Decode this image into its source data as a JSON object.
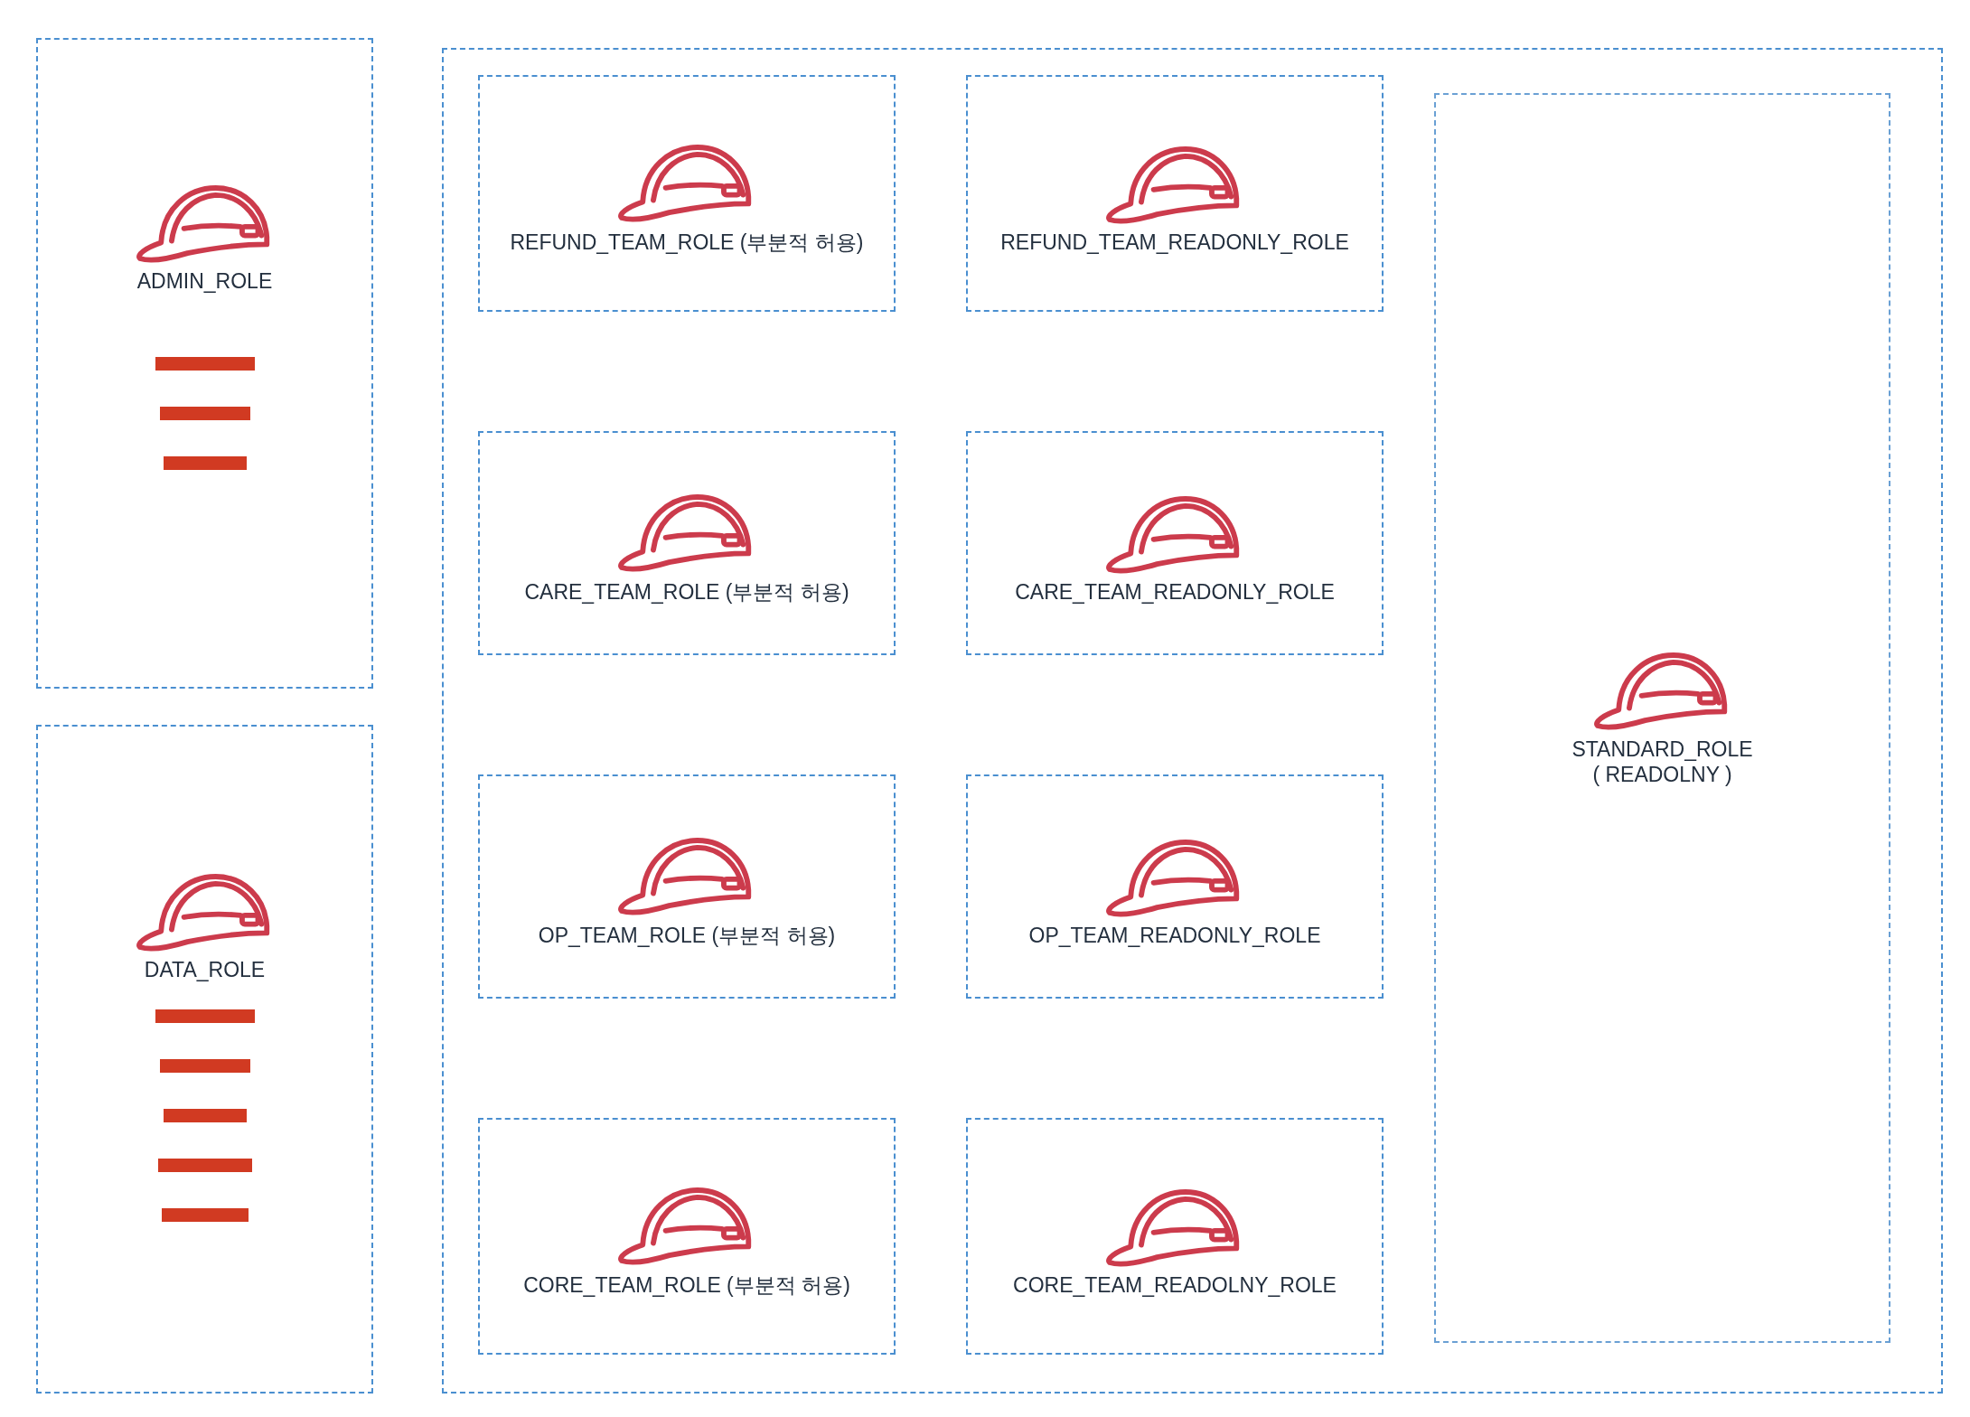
{
  "user_groups": [
    {
      "role": "ADMIN_ROLE",
      "members": [
        {
          "kind": "redacted"
        },
        {
          "kind": "redacted"
        },
        {
          "kind": "redacted"
        }
      ]
    },
    {
      "role": "DATA_ROLE",
      "members": [
        {
          "kind": "redacted"
        },
        {
          "kind": "redacted"
        },
        {
          "kind": "redacted"
        },
        {
          "kind": "redacted"
        },
        {
          "kind": "redacted"
        }
      ]
    }
  ],
  "team_roles": [
    {
      "label": "REFUND_TEAM_ROLE (부분적 허용)"
    },
    {
      "label": "REFUND_TEAM_READONLY_ROLE"
    },
    {
      "label": "CARE_TEAM_ROLE (부분적 허용)"
    },
    {
      "label": "CARE_TEAM_READONLY_ROLE"
    },
    {
      "label": "OP_TEAM_ROLE (부분적 허용)"
    },
    {
      "label": "OP_TEAM_READONLY_ROLE"
    },
    {
      "label": "CORE_TEAM_ROLE (부분적 허용)"
    },
    {
      "label": "CORE_TEAM_READOLNY_ROLE"
    }
  ],
  "standard_role": {
    "lines": [
      "STANDARD_ROLE",
      "( READOLNY )"
    ]
  }
}
